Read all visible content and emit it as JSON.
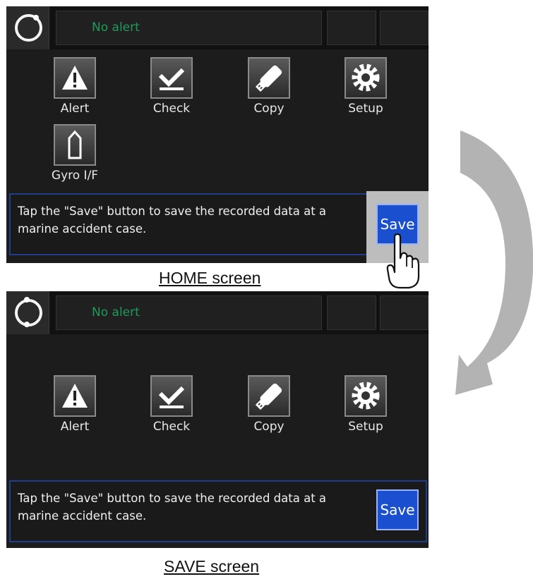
{
  "home": {
    "caption": "HOME screen",
    "alert_text": "No alert",
    "apps": [
      {
        "label": "Alert",
        "icon": "warning-triangle-icon"
      },
      {
        "label": "Check",
        "icon": "checkmark-icon"
      },
      {
        "label": "Copy",
        "icon": "usb-drive-icon"
      },
      {
        "label": "Setup",
        "icon": "gear-icon"
      },
      {
        "label": "Gyro I/F",
        "icon": "ship-bow-icon"
      }
    ],
    "message": "Tap the \"Save\" button to save the recorded data at a marine accident case.",
    "save_label": "Save"
  },
  "save": {
    "caption": "SAVE screen",
    "alert_text": "No alert",
    "apps": [
      {
        "label": "Alert",
        "icon": "warning-triangle-icon"
      },
      {
        "label": "Check",
        "icon": "checkmark-icon"
      },
      {
        "label": "Copy",
        "icon": "usb-drive-icon"
      },
      {
        "label": "Setup",
        "icon": "gear-icon"
      }
    ],
    "message": "Tap the \"Save\" button to save the recorded data at a marine accident case.",
    "save_label": "Save"
  },
  "colors": {
    "screen_bg": "#1c1c1c",
    "alert_text": "#1f9a5a",
    "save_button": "#1a4fd0",
    "panel_border": "#203d8c",
    "arrow": "#b3b3b3"
  }
}
